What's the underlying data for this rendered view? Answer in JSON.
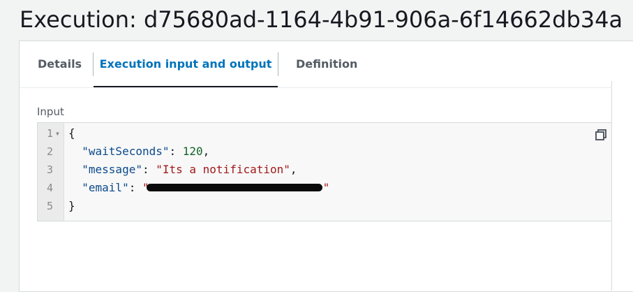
{
  "header": {
    "title": "Execution: d75680ad-1164-4b91-906a-6f14662db34a"
  },
  "tabs": [
    {
      "label": "Details",
      "active": false
    },
    {
      "label": "Execution input and output",
      "active": true
    },
    {
      "label": "Definition",
      "active": false
    }
  ],
  "input": {
    "label": "Input",
    "line_numbers": [
      "1",
      "2",
      "3",
      "4",
      "5"
    ],
    "lines": {
      "open_brace": "{",
      "key_wait": "\"waitSeconds\"",
      "val_wait": "120",
      "key_message": "\"message\"",
      "val_message": "\"Its a notification\"",
      "key_email": "\"email\"",
      "val_email_open": "\"",
      "val_email_close": "\"",
      "close_brace": "}"
    },
    "icons": {
      "copy": "copy-icon",
      "fold": "fold-arrow-icon"
    }
  },
  "colors": {
    "active_tab": "#0073bb",
    "json_key": "#0b4a8b",
    "json_number": "#116329",
    "json_string": "#a11a1a"
  }
}
